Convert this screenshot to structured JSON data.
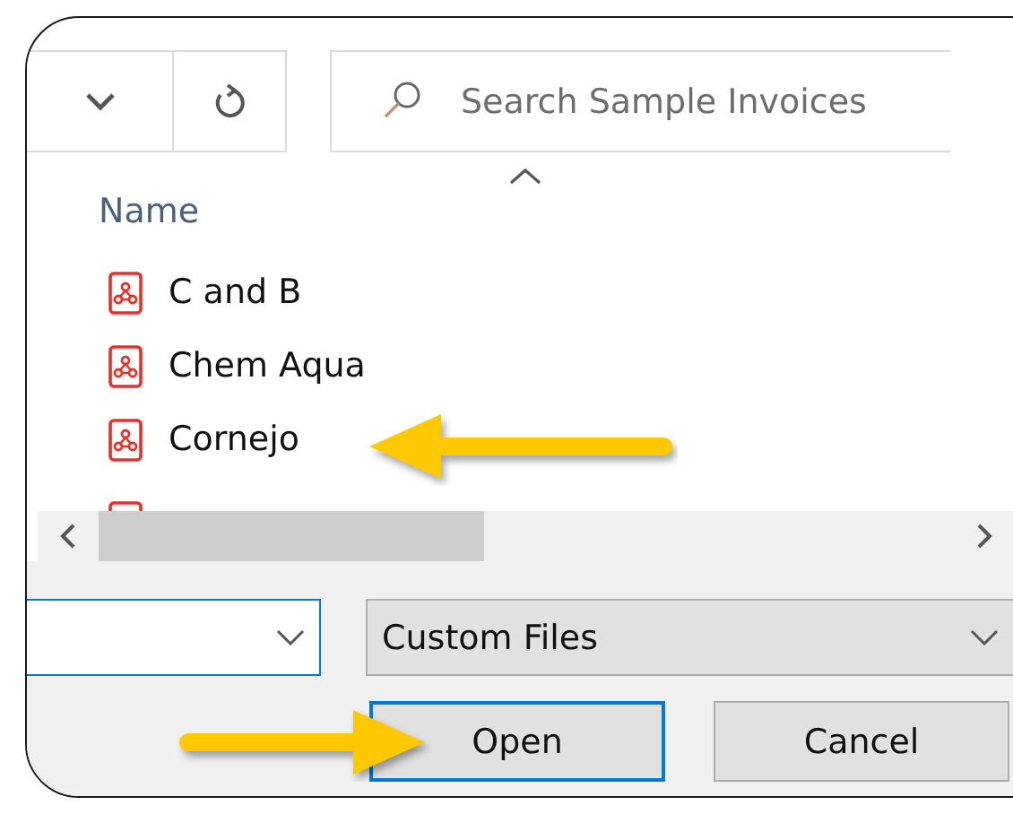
{
  "search": {
    "placeholder": "Search Sample Invoices"
  },
  "list": {
    "column": "Name",
    "files": [
      {
        "name": "C and B",
        "selected": false
      },
      {
        "name": "Chem Aqua",
        "selected": false
      },
      {
        "name": "Cornejo",
        "selected": false
      }
    ]
  },
  "file_type": {
    "value": "Custom Files"
  },
  "buttons": [
    {
      "label": "Open",
      "default": true
    },
    {
      "label": "Cancel",
      "default": false
    }
  ]
}
